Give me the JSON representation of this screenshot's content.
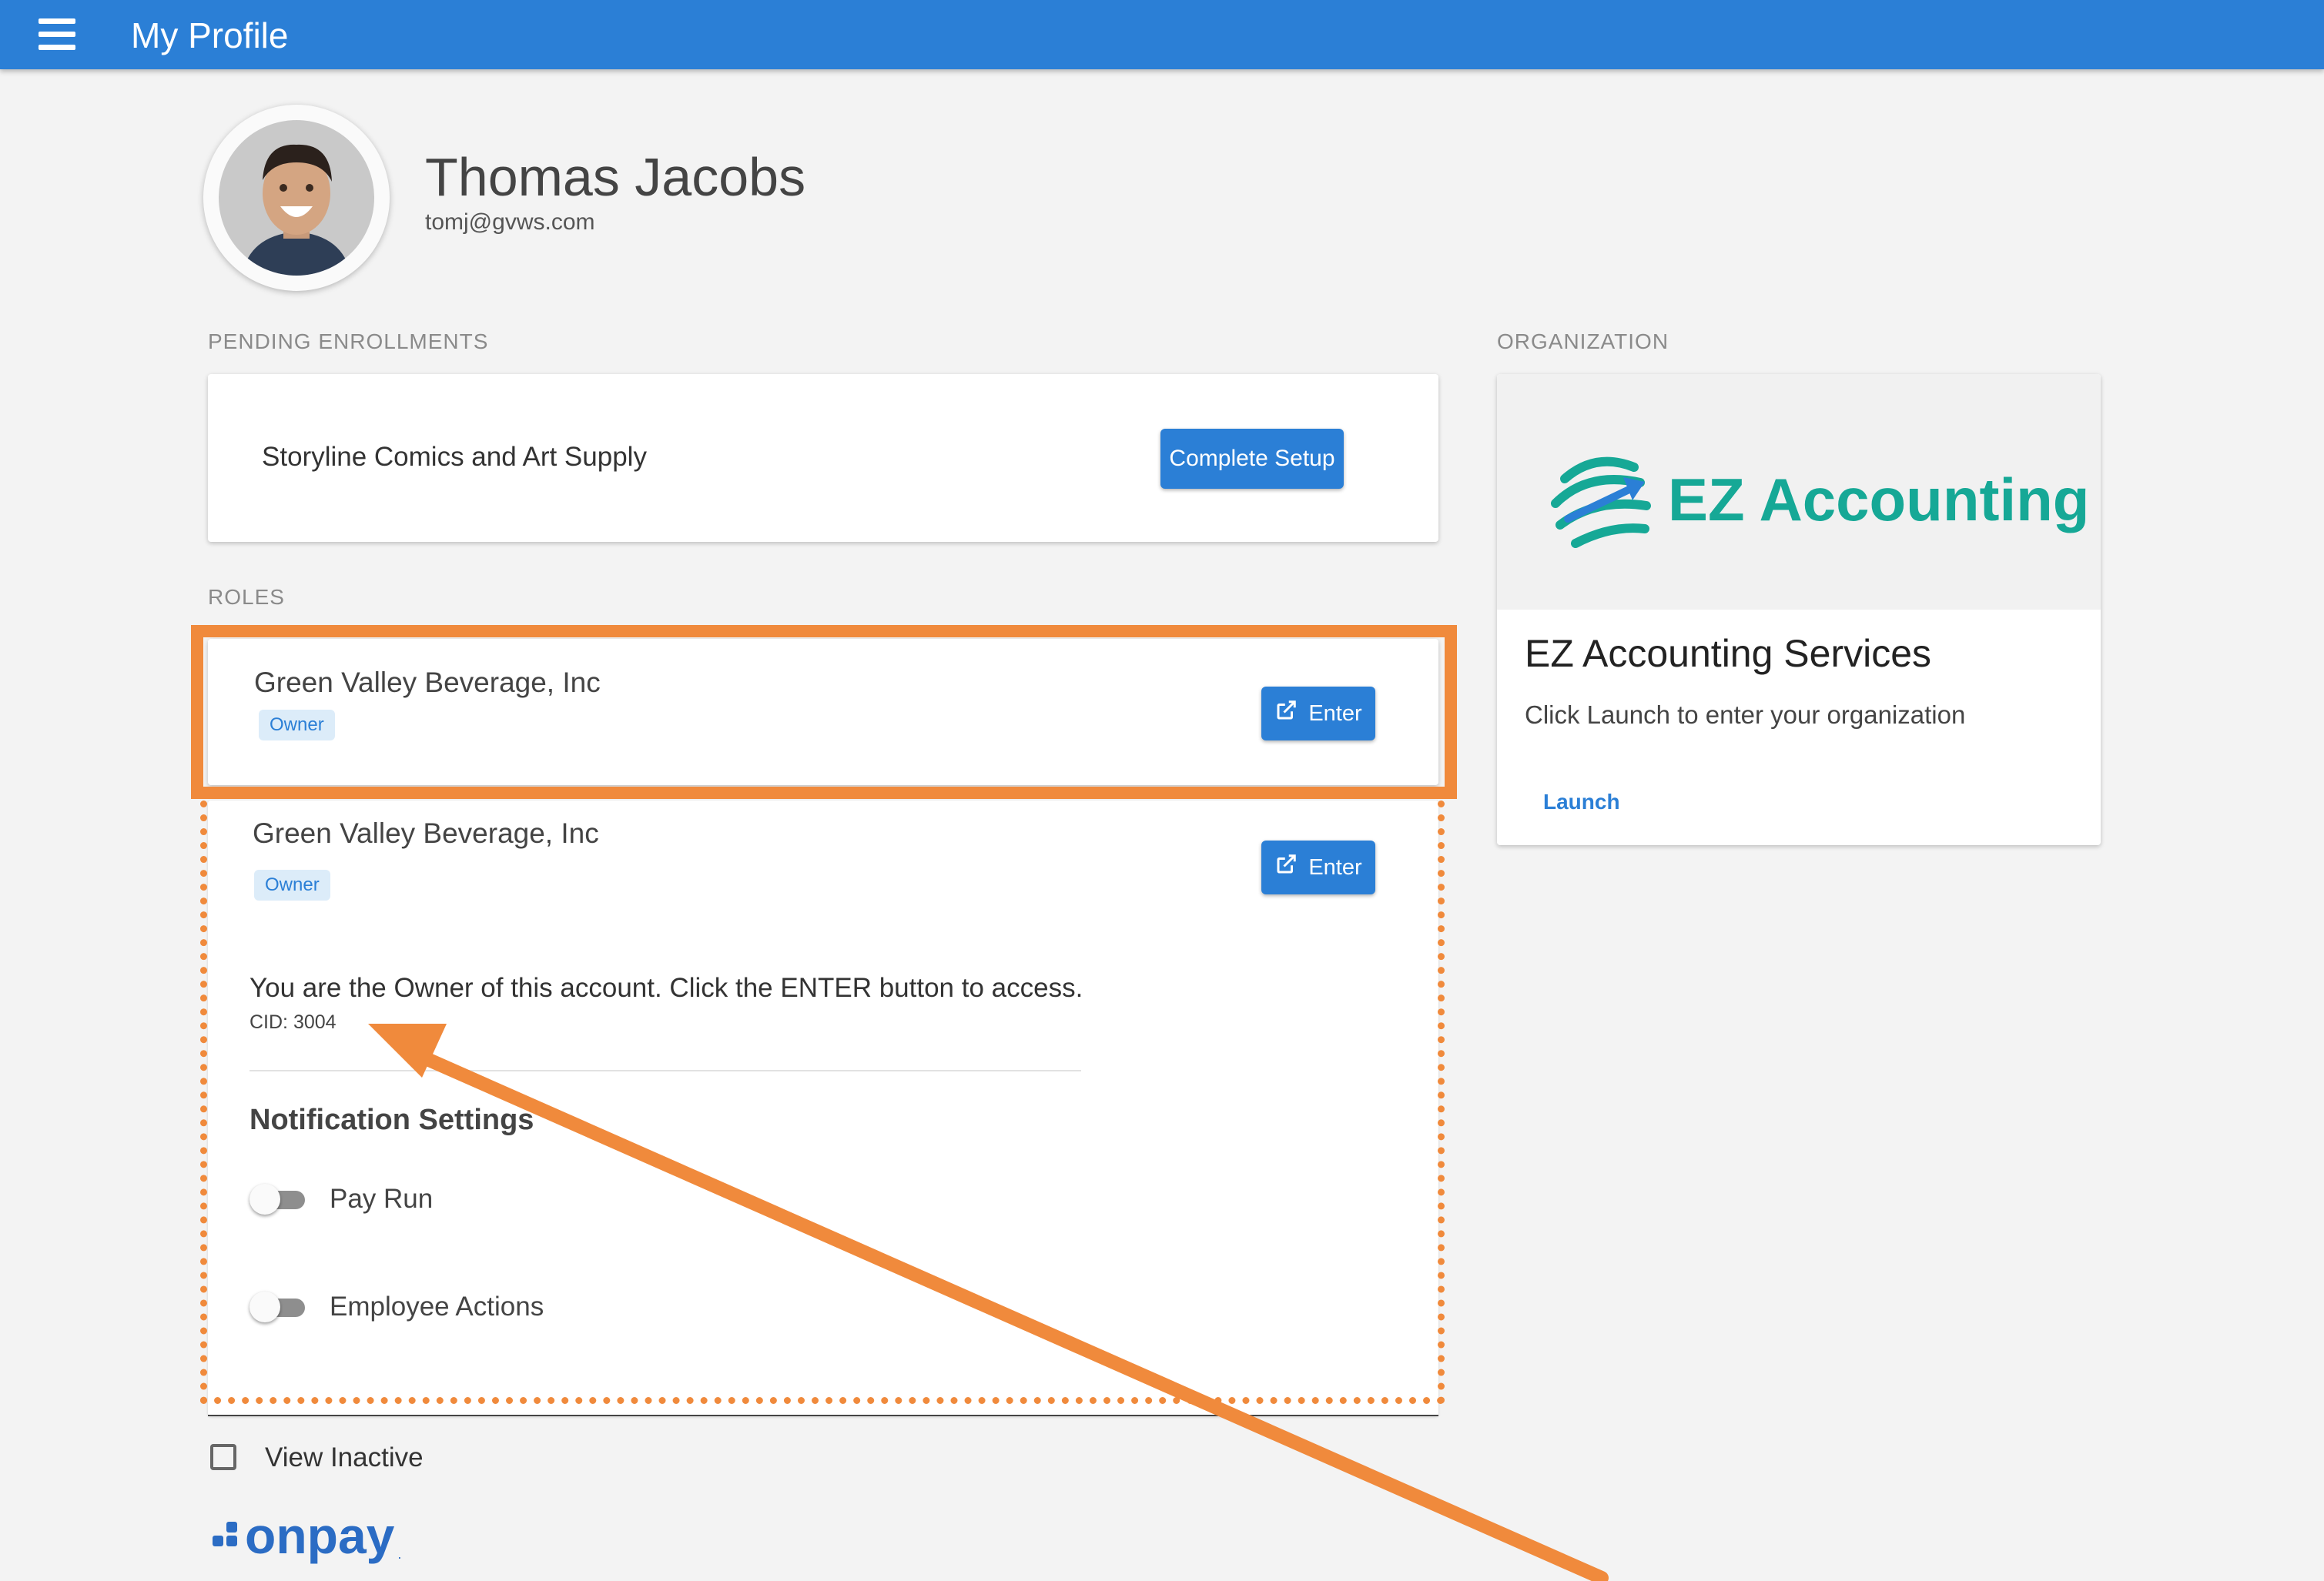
{
  "header": {
    "title": "My Profile",
    "menu_icon": "hamburger-menu-icon"
  },
  "profile": {
    "name": "Thomas Jacobs",
    "email": "tomj@gvws.com"
  },
  "pending": {
    "label": "PENDING ENROLLMENTS",
    "company": "Storyline Comics and Art Supply",
    "button": "Complete Setup"
  },
  "roles": {
    "label": "ROLES",
    "items": [
      {
        "company": "Green Valley Beverage, Inc",
        "badge": "Owner",
        "button": "Enter"
      },
      {
        "company": "Green Valley Beverage, Inc",
        "badge": "Owner",
        "button": "Enter"
      }
    ],
    "detail": {
      "message": "You are the Owner of this account. Click the ENTER button to access.",
      "cid": "CID: 3004",
      "notif_title": "Notification Settings",
      "toggles": [
        {
          "label": "Pay Run",
          "on": false
        },
        {
          "label": "Employee Actions",
          "on": false
        }
      ]
    },
    "view_inactive": "View Inactive"
  },
  "organization": {
    "label": "ORGANIZATION",
    "logo_text": "EZ Accounting",
    "name": "EZ Accounting Services",
    "description": "Click Launch to enter your organization",
    "action": "Launch"
  },
  "footer": {
    "brand": "onpay",
    "brand_mark": "."
  },
  "colors": {
    "primary": "#2b7fd6",
    "annotation": "#f08a3c",
    "logo_green": "#16a896",
    "background": "#f3f3f3"
  }
}
